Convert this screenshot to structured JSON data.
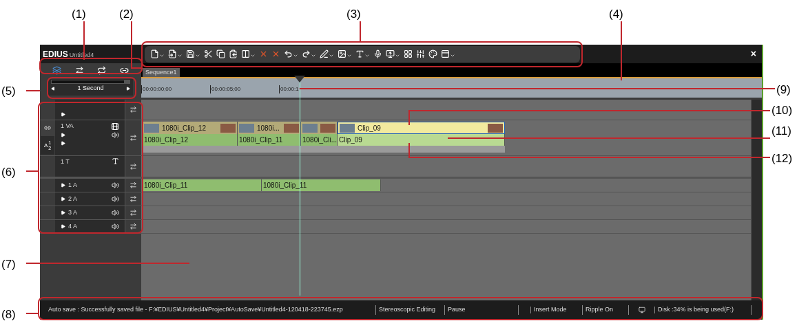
{
  "callouts": [
    {
      "label": "(1)"
    },
    {
      "label": "(2)"
    },
    {
      "label": "(3)"
    },
    {
      "label": "(4)"
    },
    {
      "label": "(5)"
    },
    {
      "label": "(6)"
    },
    {
      "label": "(7)"
    },
    {
      "label": "(8)"
    },
    {
      "label": "(9)"
    },
    {
      "label": "(10)"
    },
    {
      "label": "(11)"
    },
    {
      "label": "(12)"
    }
  ],
  "window": {
    "app": "EDIUS",
    "project": "Untitled4",
    "close": "×"
  },
  "sequence_tab": {
    "label": "Sequence1",
    "selected": true
  },
  "zoom": {
    "value": "1 Second",
    "level": 0.93
  },
  "ruler": {
    "timecodes": [
      "00:00:00;00",
      "00:00:05;00",
      "00:00:1"
    ]
  },
  "tracks": [
    {
      "kind": "empty"
    },
    {
      "kind": "va",
      "name": "1 VA",
      "patch": "A",
      "channels": [
        "1",
        "2"
      ],
      "clips": [
        {
          "label": "1080i_Clip_12",
          "selected": false
        },
        {
          "label": "1080i...",
          "selected": false
        },
        {
          "selected": false
        },
        {
          "label": "Clip_09",
          "selected": true
        }
      ],
      "audio_clips": [
        {
          "label": "1080i_Clip_12",
          "selected": false
        },
        {
          "label": "1080i_Clip_11",
          "selected": false
        },
        {
          "label": "1080i_Cli...",
          "selected": false
        },
        {
          "label": "Clip_09",
          "selected": true
        }
      ]
    },
    {
      "kind": "title",
      "name": "1 T"
    },
    {
      "kind": "audio",
      "name": "1 A",
      "clips": [
        {
          "label": "1080i_Clip_11",
          "selected": false
        },
        {
          "label": "1080i_Clip_11",
          "selected": false
        }
      ]
    },
    {
      "kind": "audio",
      "name": "2 A"
    },
    {
      "kind": "audio",
      "name": "3 A"
    },
    {
      "kind": "audio",
      "name": "4 A"
    }
  ],
  "status_bar": [
    {
      "kind": "text",
      "text": "Auto save : Successfully saved file - F:¥EDIUS¥Untitled4¥Project¥AutoSave¥Untitled4-120418-223745.ezp"
    },
    {
      "kind": "text",
      "text": "Stereoscopic Editing"
    },
    {
      "kind": "text",
      "text": "Pause"
    },
    {
      "kind": "blank"
    },
    {
      "kind": "text",
      "text": "Insert Mode"
    },
    {
      "kind": "text",
      "text": "Ripple On"
    },
    {
      "kind": "icon"
    },
    {
      "kind": "text",
      "text": "Disk :34% is being used(F:)"
    }
  ]
}
